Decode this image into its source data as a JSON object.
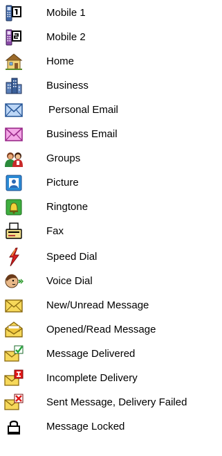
{
  "legend": {
    "items": [
      {
        "icon": "mobile-1-icon",
        "label": "Mobile 1"
      },
      {
        "icon": "mobile-2-icon",
        "label": "Mobile 2"
      },
      {
        "icon": "home-icon",
        "label": "Home"
      },
      {
        "icon": "business-icon",
        "label": "Business"
      },
      {
        "icon": "personal-email-icon",
        "label": "Personal Email"
      },
      {
        "icon": "business-email-icon",
        "label": "Business Email"
      },
      {
        "icon": "groups-icon",
        "label": "Groups"
      },
      {
        "icon": "picture-icon",
        "label": "Picture"
      },
      {
        "icon": "ringtone-icon",
        "label": "Ringtone"
      },
      {
        "icon": "fax-icon",
        "label": "Fax"
      },
      {
        "icon": "speed-dial-icon",
        "label": "Speed Dial"
      },
      {
        "icon": "voice-dial-icon",
        "label": "Voice Dial"
      },
      {
        "icon": "new-unread-message-icon",
        "label": "New/Unread Message"
      },
      {
        "icon": "opened-read-message-icon",
        "label": "Opened/Read Message"
      },
      {
        "icon": "message-delivered-icon",
        "label": "Message Delivered"
      },
      {
        "icon": "incomplete-delivery-icon",
        "label": "Incomplete Delivery"
      },
      {
        "icon": "delivery-failed-icon",
        "label": "Sent Message, Delivery Failed"
      },
      {
        "icon": "message-locked-icon",
        "label": "Message Locked"
      }
    ]
  },
  "colors": {
    "text": "#000000",
    "personal_email": "#bcd6f6",
    "business_email": "#f3a6e6",
    "unread_envelope": "#f6d85a",
    "delivered_check": "#22a83a",
    "failed_x": "#e01818",
    "picture_frame": "#2b8bd6",
    "ringtone_frame": "#3fae3f"
  }
}
